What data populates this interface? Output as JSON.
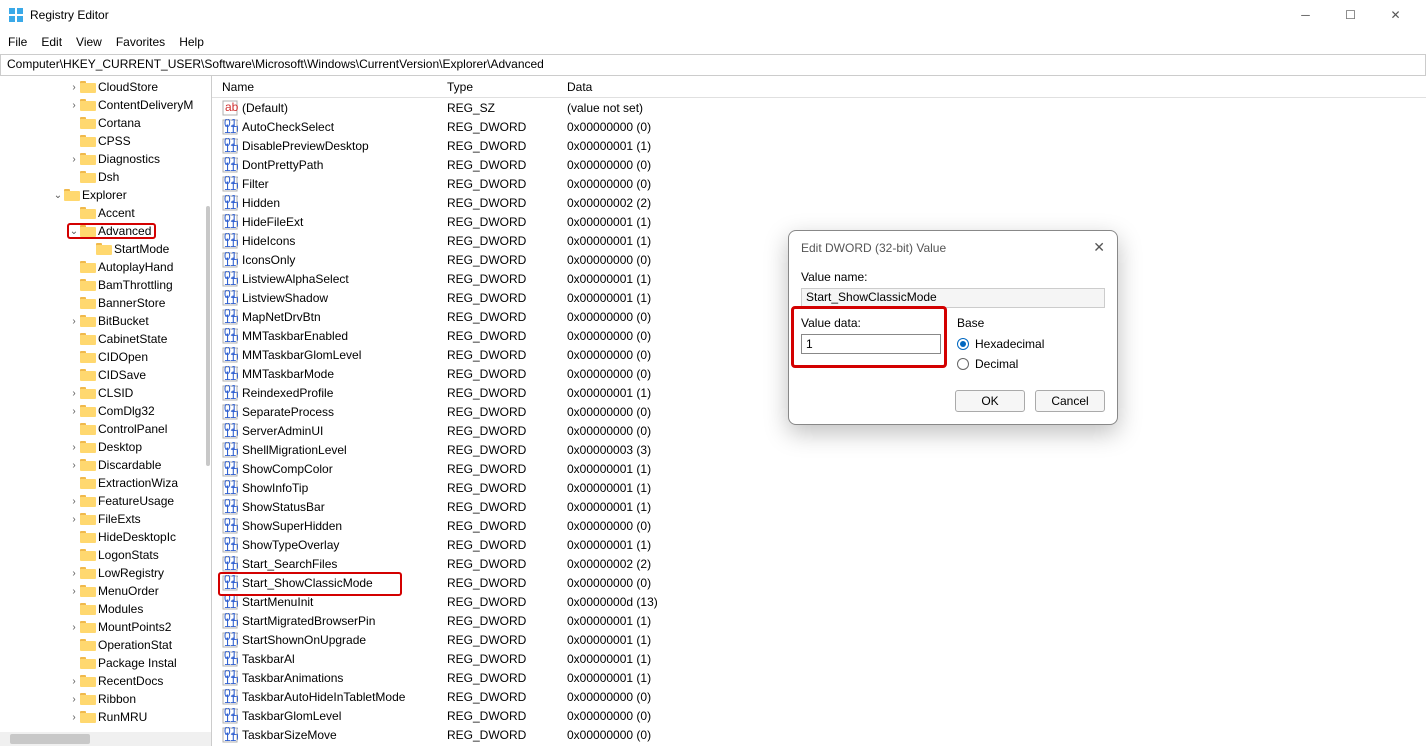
{
  "window": {
    "title": "Registry Editor"
  },
  "menu": [
    "File",
    "Edit",
    "View",
    "Favorites",
    "Help"
  ],
  "address": "Computer\\HKEY_CURRENT_USER\\Software\\Microsoft\\Windows\\CurrentVersion\\Explorer\\Advanced",
  "tree": [
    {
      "depth": 4,
      "exp": ">",
      "label": "CloudStore"
    },
    {
      "depth": 4,
      "exp": ">",
      "label": "ContentDeliveryM"
    },
    {
      "depth": 4,
      "exp": "",
      "label": "Cortana"
    },
    {
      "depth": 4,
      "exp": "",
      "label": "CPSS"
    },
    {
      "depth": 4,
      "exp": ">",
      "label": "Diagnostics"
    },
    {
      "depth": 4,
      "exp": "",
      "label": "Dsh"
    },
    {
      "depth": 3,
      "exp": "v",
      "label": "Explorer"
    },
    {
      "depth": 4,
      "exp": "",
      "label": "Accent"
    },
    {
      "depth": 4,
      "exp": "v",
      "label": "Advanced",
      "selected": true
    },
    {
      "depth": 5,
      "exp": "",
      "label": "StartMode"
    },
    {
      "depth": 4,
      "exp": "",
      "label": "AutoplayHand"
    },
    {
      "depth": 4,
      "exp": "",
      "label": "BamThrottling"
    },
    {
      "depth": 4,
      "exp": "",
      "label": "BannerStore"
    },
    {
      "depth": 4,
      "exp": ">",
      "label": "BitBucket"
    },
    {
      "depth": 4,
      "exp": "",
      "label": "CabinetState"
    },
    {
      "depth": 4,
      "exp": "",
      "label": "CIDOpen"
    },
    {
      "depth": 4,
      "exp": "",
      "label": "CIDSave"
    },
    {
      "depth": 4,
      "exp": ">",
      "label": "CLSID"
    },
    {
      "depth": 4,
      "exp": ">",
      "label": "ComDlg32"
    },
    {
      "depth": 4,
      "exp": "",
      "label": "ControlPanel"
    },
    {
      "depth": 4,
      "exp": ">",
      "label": "Desktop"
    },
    {
      "depth": 4,
      "exp": ">",
      "label": "Discardable"
    },
    {
      "depth": 4,
      "exp": "",
      "label": "ExtractionWiza"
    },
    {
      "depth": 4,
      "exp": ">",
      "label": "FeatureUsage"
    },
    {
      "depth": 4,
      "exp": ">",
      "label": "FileExts"
    },
    {
      "depth": 4,
      "exp": "",
      "label": "HideDesktopIc"
    },
    {
      "depth": 4,
      "exp": "",
      "label": "LogonStats"
    },
    {
      "depth": 4,
      "exp": ">",
      "label": "LowRegistry"
    },
    {
      "depth": 4,
      "exp": ">",
      "label": "MenuOrder"
    },
    {
      "depth": 4,
      "exp": "",
      "label": "Modules"
    },
    {
      "depth": 4,
      "exp": ">",
      "label": "MountPoints2"
    },
    {
      "depth": 4,
      "exp": "",
      "label": "OperationStat"
    },
    {
      "depth": 4,
      "exp": "",
      "label": "Package Instal"
    },
    {
      "depth": 4,
      "exp": ">",
      "label": "RecentDocs"
    },
    {
      "depth": 4,
      "exp": ">",
      "label": "Ribbon"
    },
    {
      "depth": 4,
      "exp": ">",
      "label": "RunMRU"
    }
  ],
  "columns": {
    "name": "Name",
    "type": "Type",
    "data": "Data"
  },
  "values": [
    {
      "icon": "sz",
      "name": "(Default)",
      "type": "REG_SZ",
      "data": "(value not set)"
    },
    {
      "icon": "dw",
      "name": "AutoCheckSelect",
      "type": "REG_DWORD",
      "data": "0x00000000 (0)"
    },
    {
      "icon": "dw",
      "name": "DisablePreviewDesktop",
      "type": "REG_DWORD",
      "data": "0x00000001 (1)"
    },
    {
      "icon": "dw",
      "name": "DontPrettyPath",
      "type": "REG_DWORD",
      "data": "0x00000000 (0)"
    },
    {
      "icon": "dw",
      "name": "Filter",
      "type": "REG_DWORD",
      "data": "0x00000000 (0)"
    },
    {
      "icon": "dw",
      "name": "Hidden",
      "type": "REG_DWORD",
      "data": "0x00000002 (2)"
    },
    {
      "icon": "dw",
      "name": "HideFileExt",
      "type": "REG_DWORD",
      "data": "0x00000001 (1)"
    },
    {
      "icon": "dw",
      "name": "HideIcons",
      "type": "REG_DWORD",
      "data": "0x00000001 (1)"
    },
    {
      "icon": "dw",
      "name": "IconsOnly",
      "type": "REG_DWORD",
      "data": "0x00000000 (0)"
    },
    {
      "icon": "dw",
      "name": "ListviewAlphaSelect",
      "type": "REG_DWORD",
      "data": "0x00000001 (1)"
    },
    {
      "icon": "dw",
      "name": "ListviewShadow",
      "type": "REG_DWORD",
      "data": "0x00000001 (1)"
    },
    {
      "icon": "dw",
      "name": "MapNetDrvBtn",
      "type": "REG_DWORD",
      "data": "0x00000000 (0)"
    },
    {
      "icon": "dw",
      "name": "MMTaskbarEnabled",
      "type": "REG_DWORD",
      "data": "0x00000000 (0)"
    },
    {
      "icon": "dw",
      "name": "MMTaskbarGlomLevel",
      "type": "REG_DWORD",
      "data": "0x00000000 (0)"
    },
    {
      "icon": "dw",
      "name": "MMTaskbarMode",
      "type": "REG_DWORD",
      "data": "0x00000000 (0)"
    },
    {
      "icon": "dw",
      "name": "ReindexedProfile",
      "type": "REG_DWORD",
      "data": "0x00000001 (1)"
    },
    {
      "icon": "dw",
      "name": "SeparateProcess",
      "type": "REG_DWORD",
      "data": "0x00000000 (0)"
    },
    {
      "icon": "dw",
      "name": "ServerAdminUI",
      "type": "REG_DWORD",
      "data": "0x00000000 (0)"
    },
    {
      "icon": "dw",
      "name": "ShellMigrationLevel",
      "type": "REG_DWORD",
      "data": "0x00000003 (3)"
    },
    {
      "icon": "dw",
      "name": "ShowCompColor",
      "type": "REG_DWORD",
      "data": "0x00000001 (1)"
    },
    {
      "icon": "dw",
      "name": "ShowInfoTip",
      "type": "REG_DWORD",
      "data": "0x00000001 (1)"
    },
    {
      "icon": "dw",
      "name": "ShowStatusBar",
      "type": "REG_DWORD",
      "data": "0x00000001 (1)"
    },
    {
      "icon": "dw",
      "name": "ShowSuperHidden",
      "type": "REG_DWORD",
      "data": "0x00000000 (0)"
    },
    {
      "icon": "dw",
      "name": "ShowTypeOverlay",
      "type": "REG_DWORD",
      "data": "0x00000001 (1)"
    },
    {
      "icon": "dw",
      "name": "Start_SearchFiles",
      "type": "REG_DWORD",
      "data": "0x00000002 (2)"
    },
    {
      "icon": "dw",
      "name": "Start_ShowClassicMode",
      "type": "REG_DWORD",
      "data": "0x00000000 (0)",
      "highlight": true
    },
    {
      "icon": "dw",
      "name": "StartMenuInit",
      "type": "REG_DWORD",
      "data": "0x0000000d (13)"
    },
    {
      "icon": "dw",
      "name": "StartMigratedBrowserPin",
      "type": "REG_DWORD",
      "data": "0x00000001 (1)"
    },
    {
      "icon": "dw",
      "name": "StartShownOnUpgrade",
      "type": "REG_DWORD",
      "data": "0x00000001 (1)"
    },
    {
      "icon": "dw",
      "name": "TaskbarAl",
      "type": "REG_DWORD",
      "data": "0x00000001 (1)"
    },
    {
      "icon": "dw",
      "name": "TaskbarAnimations",
      "type": "REG_DWORD",
      "data": "0x00000001 (1)"
    },
    {
      "icon": "dw",
      "name": "TaskbarAutoHideInTabletMode",
      "type": "REG_DWORD",
      "data": "0x00000000 (0)"
    },
    {
      "icon": "dw",
      "name": "TaskbarGlomLevel",
      "type": "REG_DWORD",
      "data": "0x00000000 (0)"
    },
    {
      "icon": "dw",
      "name": "TaskbarSizeMove",
      "type": "REG_DWORD",
      "data": "0x00000000 (0)"
    }
  ],
  "dialog": {
    "title": "Edit DWORD (32-bit) Value",
    "valueNameLabel": "Value name:",
    "valueName": "Start_ShowClassicMode",
    "valueDataLabel": "Value data:",
    "valueData": "1",
    "baseLabel": "Base",
    "radioHex": "Hexadecimal",
    "radioDec": "Decimal",
    "ok": "OK",
    "cancel": "Cancel"
  }
}
